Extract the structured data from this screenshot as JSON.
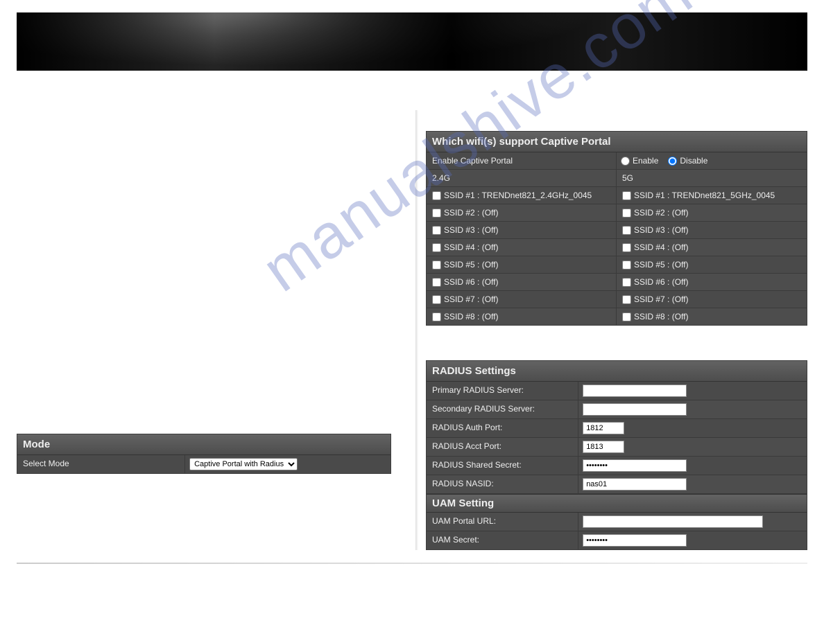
{
  "left": {
    "link_placeholder": "",
    "midlink_placeholder": "",
    "mode": {
      "header": "Mode",
      "select_label": "Select Mode",
      "select_value": "Captive Portal with Radius"
    }
  },
  "right": {
    "wifi": {
      "header": "Which wifi(s) support Captive Portal",
      "enable_label": "Enable Captive Portal",
      "enable_opt": "Enable",
      "disable_opt": "Disable",
      "band24": "2.4G",
      "band5": "5G",
      "ssids24": [
        "SSID #1 : TRENDnet821_2.4GHz_0045",
        "SSID #2 : (Off)",
        "SSID #3 : (Off)",
        "SSID #4 : (Off)",
        "SSID #5 : (Off)",
        "SSID #6 : (Off)",
        "SSID #7 : (Off)",
        "SSID #8 : (Off)"
      ],
      "ssids5": [
        "SSID #1 : TRENDnet821_5GHz_0045",
        "SSID #2 : (Off)",
        "SSID #3 : (Off)",
        "SSID #4 : (Off)",
        "SSID #5 : (Off)",
        "SSID #6 : (Off)",
        "SSID #7 : (Off)",
        "SSID #8 : (Off)"
      ]
    },
    "radius": {
      "header": "RADIUS Settings",
      "primary_label": "Primary RADIUS Server:",
      "primary_value": "",
      "secondary_label": "Secondary RADIUS Server:",
      "secondary_value": "",
      "auth_port_label": "RADIUS Auth Port:",
      "auth_port_value": "1812",
      "acct_port_label": "RADIUS Acct Port:",
      "acct_port_value": "1813",
      "secret_label": "RADIUS Shared Secret:",
      "secret_value": "••••••••",
      "nasid_label": "RADIUS NASID:",
      "nasid_value": "nas01",
      "uam_header": "UAM Setting",
      "uam_url_label": "UAM Portal URL:",
      "uam_url_value": "",
      "uam_secret_label": "UAM Secret:",
      "uam_secret_value": "••••••••"
    }
  },
  "watermark": "manualshive.com"
}
